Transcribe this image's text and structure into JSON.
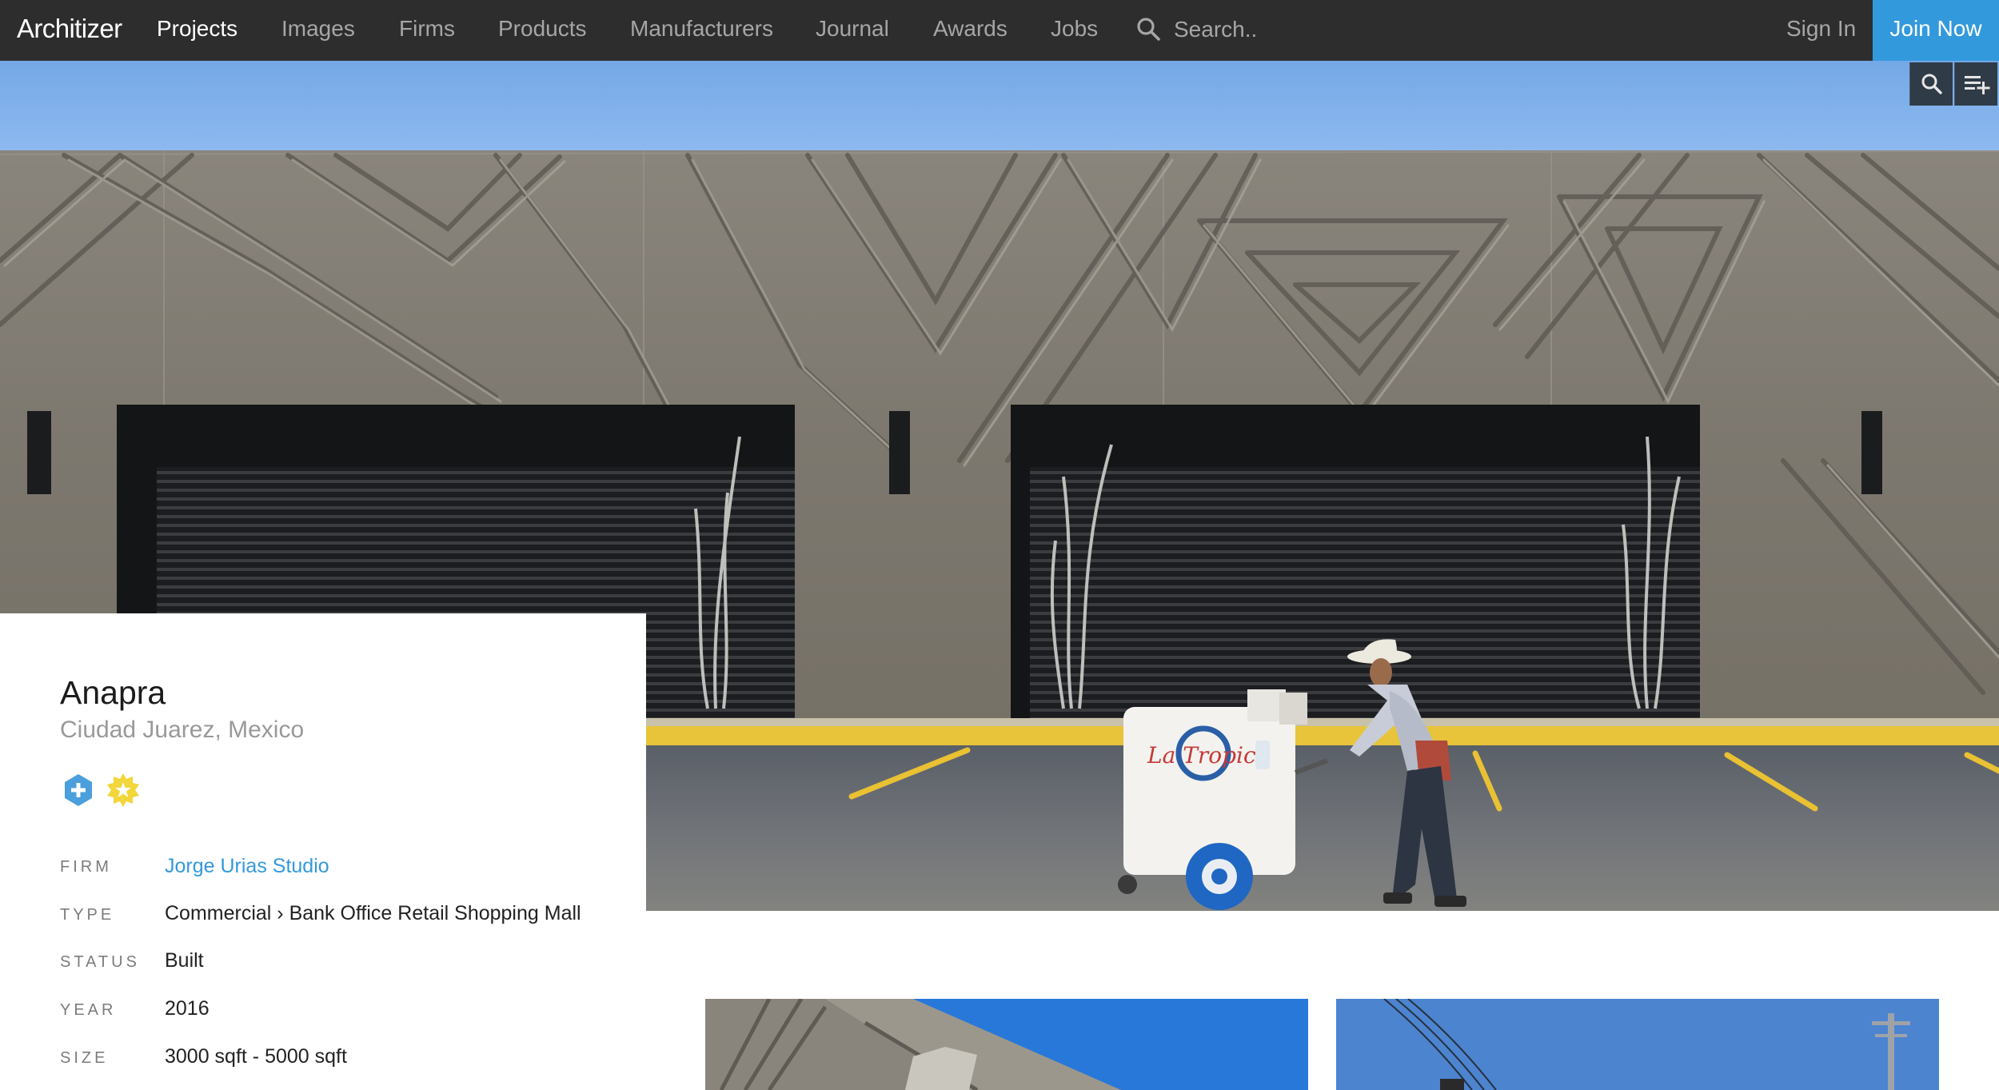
{
  "nav": {
    "logo": "Architizer",
    "items": [
      "Projects",
      "Images",
      "Firms",
      "Products",
      "Manufacturers",
      "Journal",
      "Awards",
      "Jobs"
    ],
    "active": "Projects",
    "search_placeholder": "Search..",
    "sign_in": "Sign In",
    "join_now": "Join Now"
  },
  "colors": {
    "nav_bg": "#2d2d2d",
    "accent": "#3399dd",
    "badge_plus": "#4a9fdc",
    "badge_star": "#f2d63a"
  },
  "icons": {
    "search": "search-icon",
    "image_search": "magnify-icon",
    "add_to_collection": "playlist-add-icon",
    "badge_plus": "plus-shield-icon",
    "badge_star": "star-badge-icon"
  },
  "project": {
    "title": "Anapra",
    "location": "Ciudad Juarez, Mexico",
    "details": [
      {
        "label": "FIRM",
        "value": "Jorge Urias Studio",
        "link": true
      },
      {
        "label": "TYPE",
        "value": "Commercial › Bank Office Retail Shopping Mall",
        "link": false
      },
      {
        "label": "STATUS",
        "value": "Built",
        "link": false
      },
      {
        "label": "YEAR",
        "value": "2016",
        "link": false
      },
      {
        "label": "SIZE",
        "value": "3000 sqft - 5000 sqft",
        "link": false
      }
    ]
  }
}
